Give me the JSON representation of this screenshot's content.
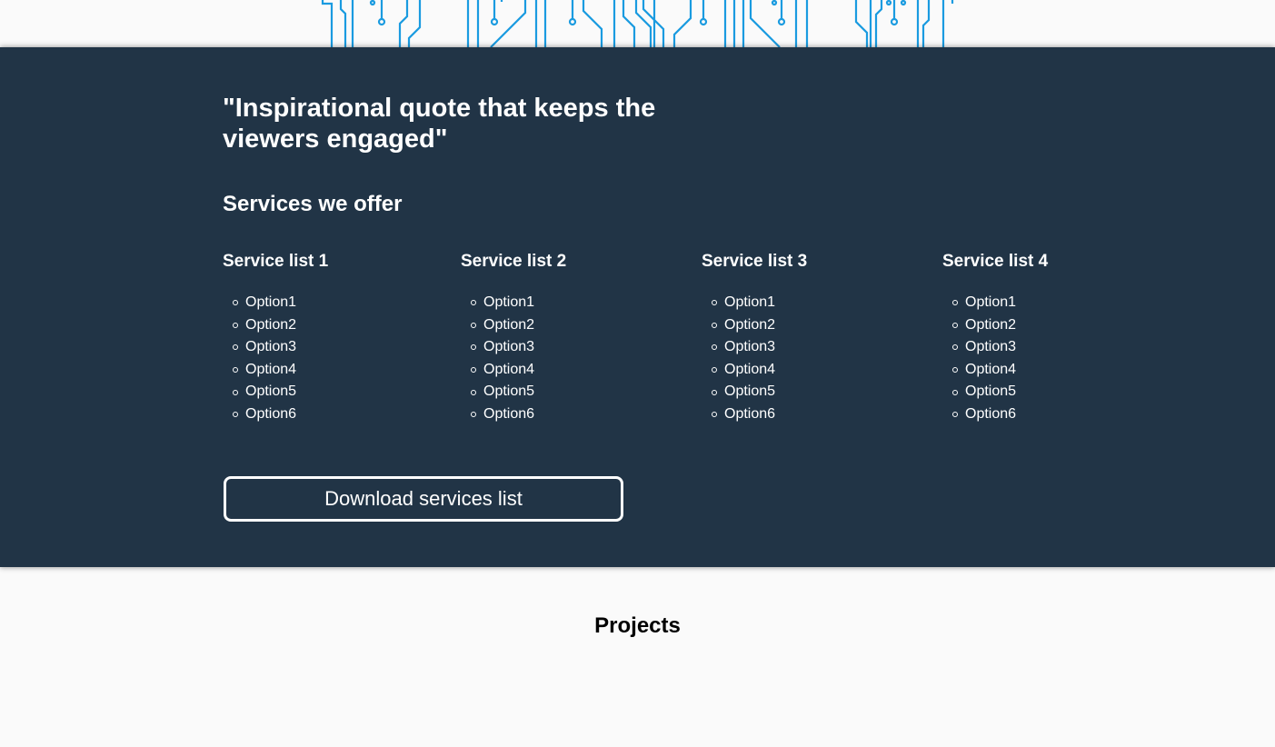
{
  "colors": {
    "band_background": "#213446",
    "page_background": "#fafafa",
    "circuit_lines": "#1a9be0",
    "text_light": "#ffffff",
    "text_dark": "#000000"
  },
  "decoration": {
    "icon": "circuit-board-graphic"
  },
  "services": {
    "quote": "\"Inspirational quote that keeps the viewers engaged\"",
    "title": "Services we offer",
    "lists": [
      {
        "title": "Service list 1",
        "options": [
          "Option1",
          "Option2",
          "Option3",
          "Option4",
          "Option5",
          "Option6"
        ]
      },
      {
        "title": "Service list 2",
        "options": [
          "Option1",
          "Option2",
          "Option3",
          "Option4",
          "Option5",
          "Option6"
        ]
      },
      {
        "title": "Service list 3",
        "options": [
          "Option1",
          "Option2",
          "Option3",
          "Option4",
          "Option5",
          "Option6"
        ]
      },
      {
        "title": "Service list 4",
        "options": [
          "Option1",
          "Option2",
          "Option3",
          "Option4",
          "Option5",
          "Option6"
        ]
      }
    ],
    "download_label": "Download services list"
  },
  "projects": {
    "title": "Projects"
  }
}
